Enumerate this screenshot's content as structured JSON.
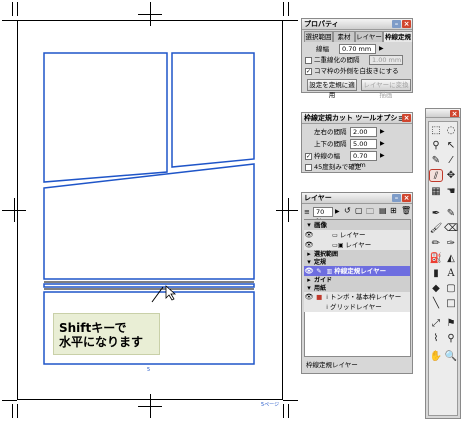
{
  "canvas": {
    "page_number": "5",
    "page_label": "5ページ",
    "note_line1": "Shiftキーで",
    "note_line2": "水平になります"
  },
  "properties": {
    "title": "プロパティ",
    "tabs": [
      "選択範囲",
      "素材",
      "レイヤー",
      "枠線定規"
    ],
    "active_tab": "枠線定規",
    "line_width_label": "線幅",
    "line_width_value": "0.70 mm",
    "double_line_label": "二重線化の間隔",
    "double_line_value": "1.00 mm",
    "outside_white_label": "コマ枠の外側を白抜きにする",
    "apply_button": "設定を定規に適用",
    "layer_convert_button": "レイヤーに変換描画"
  },
  "tool_options": {
    "title": "枠線定規カット ツールオプション",
    "lr_gap_label": "左右の間隔",
    "lr_gap_value": "2.00 mm",
    "tb_gap_label": "上下の間隔",
    "tb_gap_value": "5.00 mm",
    "frame_width_label": "枠線の幅",
    "frame_width_value": "0.70 mm",
    "snap45_label": "45度刻みで確定"
  },
  "layers": {
    "title": "レイヤー",
    "opacity": "70 %",
    "rows": [
      {
        "label": "画像",
        "type": "folder"
      },
      {
        "label": "レイヤー",
        "type": "layer"
      },
      {
        "label": "レイヤー",
        "type": "layer"
      },
      {
        "label": "選択範囲",
        "type": "folder"
      },
      {
        "label": "定規",
        "type": "folder"
      },
      {
        "label": "枠線定規レイヤー",
        "type": "selected"
      },
      {
        "label": "ガイド",
        "type": "folder"
      },
      {
        "label": "用紙",
        "type": "folder"
      },
      {
        "label": "トンボ・基本枠レイヤー",
        "type": "layer"
      },
      {
        "label": "グリッドレイヤー",
        "type": "layer"
      }
    ],
    "status": "枠線定規レイヤー"
  },
  "tools": {
    "text_tool_glyph": "A"
  },
  "colors": {
    "frame_blue": "#1f55c8",
    "selection_purple": "#6e6ee0",
    "note_bg": "#e9eed5"
  }
}
